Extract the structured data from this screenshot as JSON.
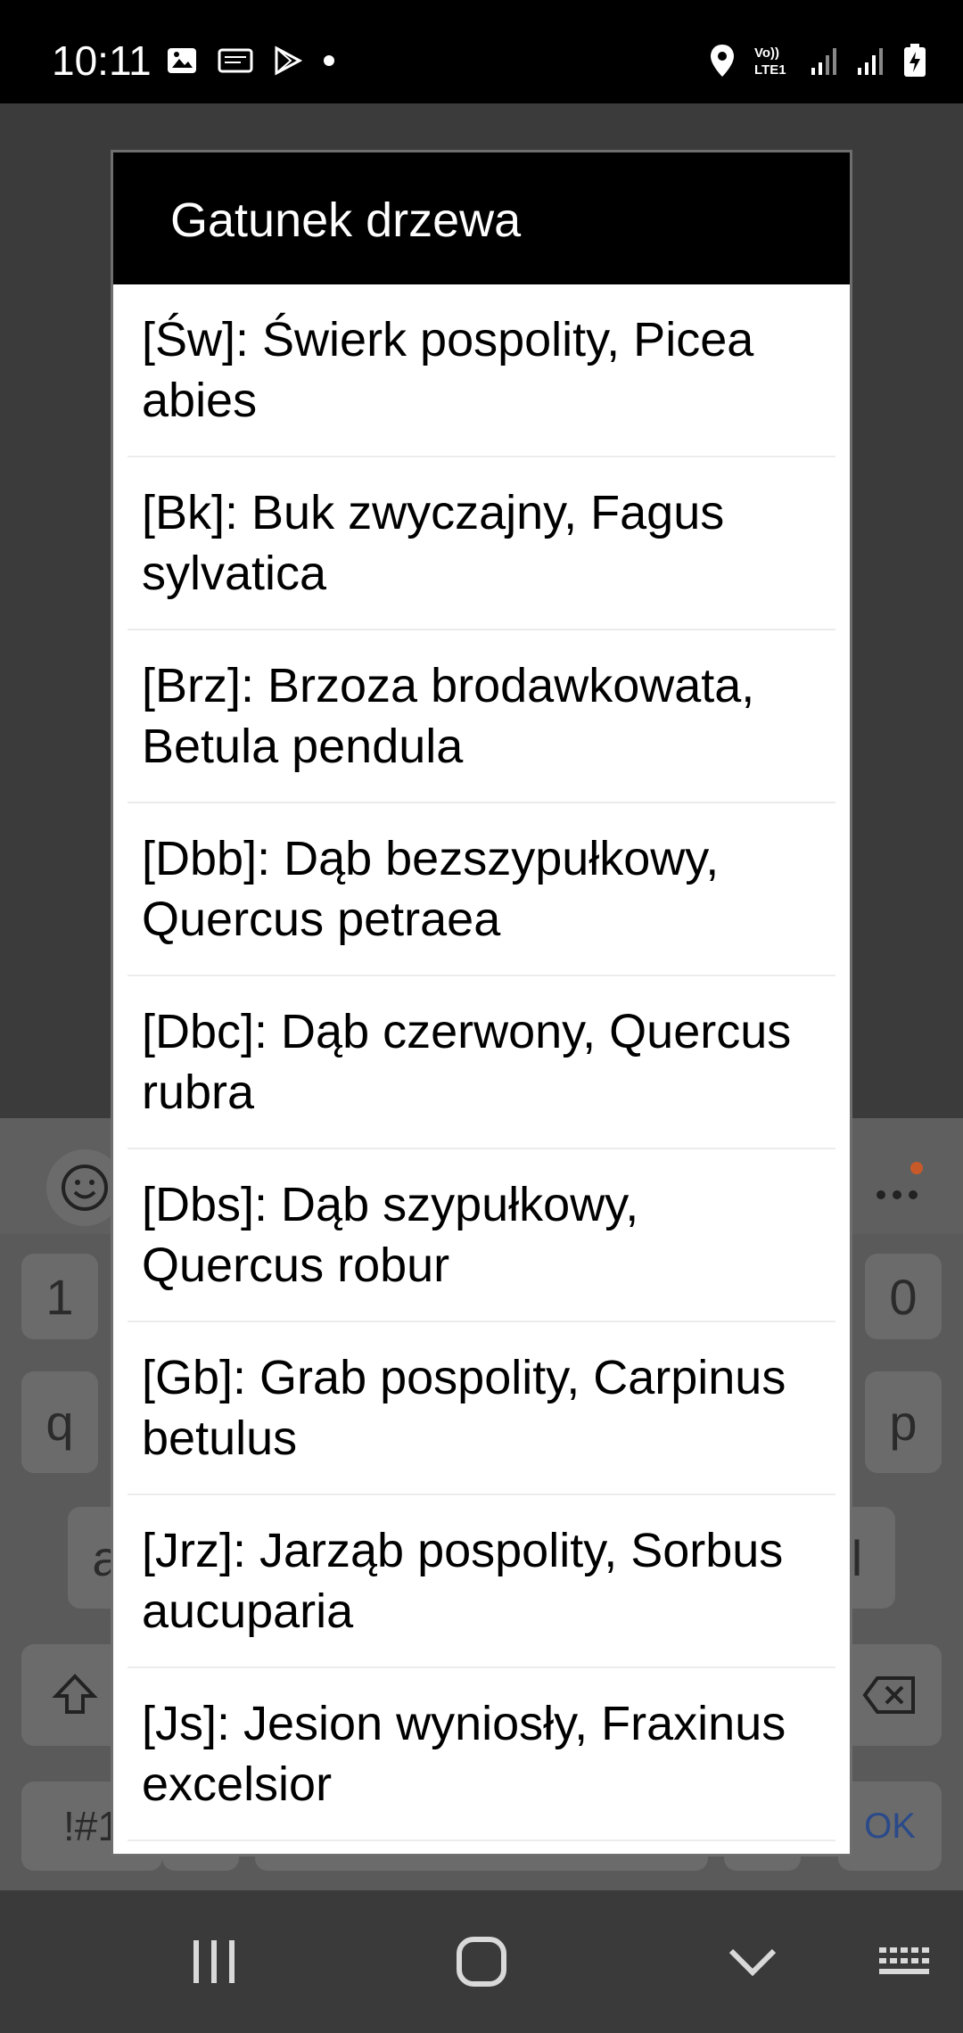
{
  "status_bar": {
    "time": "10:11",
    "icons_left": [
      "gallery-icon",
      "cast-icon",
      "play-store-icon",
      "dot-icon"
    ],
    "icons_right": [
      "location-icon",
      "volte-icon",
      "signal-1-icon",
      "signal-2-icon",
      "battery-charging-icon"
    ],
    "volte_text": "Vo))\nLTE1"
  },
  "dialog": {
    "title": "Gatunek drzewa",
    "items": [
      {
        "label": "[Św]: Świerk pospolity, Picea abies"
      },
      {
        "label": "[Bk]: Buk zwyczajny, Fagus sylvatica"
      },
      {
        "label": "[Brz]: Brzoza brodawkowata, Betula pendula"
      },
      {
        "label": "[Dbb]: Dąb bezszypułkowy, Quercus petraea"
      },
      {
        "label": "[Dbc]: Dąb czerwony, Quercus rubra"
      },
      {
        "label": "[Dbs]: Dąb szypułkowy, Quercus robur"
      },
      {
        "label": "[Gb]: Grab pospolity, Carpinus betulus"
      },
      {
        "label": "[Jrz]: Jarząb pospolity, Sorbus aucuparia"
      },
      {
        "label": "[Js]: Jesion wyniosły, Fraxinus excelsior"
      }
    ]
  },
  "keyboard_visible": {
    "key_1": "1",
    "key_0": "0",
    "key_q": "q",
    "key_p": "p",
    "key_a": "a",
    "key_l": "l",
    "symbols": "!#1",
    "ok": "OK"
  },
  "colors": {
    "dialog_header": "#000000",
    "status_bar": "#000000",
    "dim_background": "#3a3a3a",
    "ok_blue": "#2a4a8a"
  }
}
